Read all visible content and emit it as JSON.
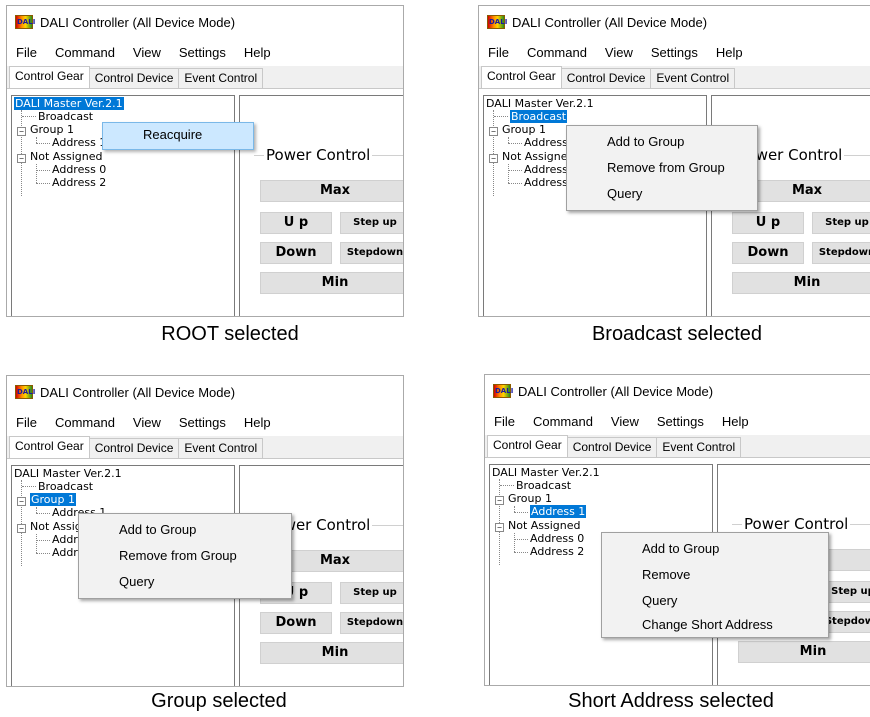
{
  "window": {
    "title": "DALI Controller (All Device Mode)",
    "icon_text": "DALI",
    "menu": [
      "File",
      "Command",
      "View",
      "Settings",
      "Help"
    ],
    "tabs": [
      "Control Gear",
      "Control Device",
      "Event Control"
    ]
  },
  "tree": {
    "root": "DALI Master Ver.2.1",
    "broadcast": "Broadcast",
    "group1": "Group 1",
    "address1": "Address 1",
    "not_assigned": "Not Assigned",
    "address0": "Address 0",
    "address2": "Address 2",
    "expander": "−"
  },
  "power_control": {
    "title": "Power Control",
    "max": "Max",
    "up": "U p",
    "step_up": "Step up",
    "down": "Down",
    "step_down": "Stepdown",
    "min": "Min"
  },
  "panels": {
    "p1": {
      "caption": "ROOT selected",
      "menu_items": [
        "Reacquire"
      ]
    },
    "p2": {
      "caption": "Broadcast selected",
      "menu_items": [
        "Add to Group",
        "Remove from Group",
        "Query"
      ]
    },
    "p3": {
      "caption": "Group selected",
      "menu_items": [
        "Add to Group",
        "Remove from Group",
        "Query"
      ]
    },
    "p4": {
      "caption": "Short Address selected",
      "menu_items": [
        "Add to Group",
        "Remove",
        "Query",
        "Change Short Address"
      ]
    }
  },
  "colors": {
    "selection": "#0078d7",
    "menu_hover": "#cce8ff",
    "button_face": "#e1e1e1"
  }
}
